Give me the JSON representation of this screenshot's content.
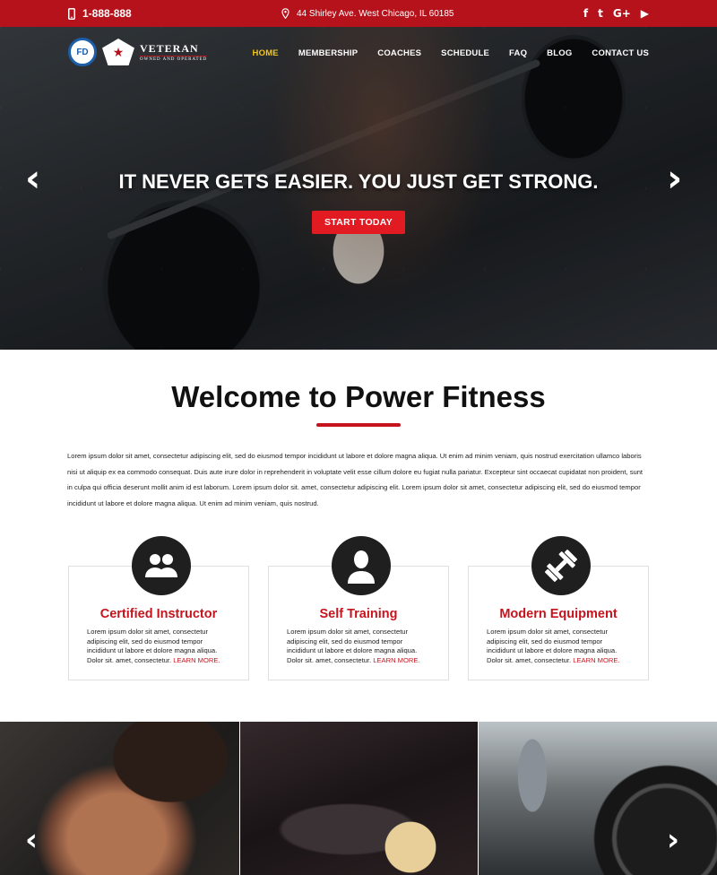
{
  "topbar": {
    "phone": "1-888-888",
    "address": "44 Shirley Ave. West Chicago, IL 60185",
    "social": [
      {
        "name": "facebook-icon",
        "glyph": "f"
      },
      {
        "name": "twitter-icon",
        "glyph": "t"
      },
      {
        "name": "google-plus-icon",
        "glyph": "G+"
      },
      {
        "name": "youtube-icon",
        "glyph": "▶"
      }
    ]
  },
  "logo": {
    "badge": "FD",
    "veteran": "VETERAN",
    "veteran_sub": "OWNED AND OPERATED"
  },
  "nav": {
    "items": [
      "HOME",
      "MEMBERSHIP",
      "COACHES",
      "SCHEDULE",
      "FAQ",
      "BLOG",
      "CONTACT US"
    ],
    "active": "HOME"
  },
  "hero": {
    "headline": "IT NEVER GETS EASIER. YOU JUST GET STRONG.",
    "cta": "START TODAY"
  },
  "welcome": {
    "title": "Welcome to Power Fitness",
    "paragraph": "Lorem ipsum dolor sit amet, consectetur adipiscing elit, sed do eiusmod tempor incididunt ut labore et dolore magna aliqua. Ut enim ad minim veniam, quis nostrud exercitation ullamco laboris nisi ut aliquip ex ea commodo consequat. Duis aute irure dolor in reprehenderit in voluptate velit esse cillum dolore eu fugiat nulla pariatur. Excepteur sint occaecat cupidatat non proident, sunt in culpa qui officia deserunt mollit anim id est laborum. Lorem ipsum dolor sit. amet, consectetur adipiscing elit. Lorem ipsum dolor sit amet, consectetur adipiscing elit, sed do eiusmod tempor incididunt ut labore et dolore magna aliqua. Ut enim ad minim veniam, quis nostrud."
  },
  "features": [
    {
      "title": "Certified Instructor",
      "icon": "group-icon",
      "text": "Lorem ipsum dolor sit amet, consectetur adipiscing elit, sed do eiusmod tempor incididunt ut labore et dolore magna aliqua. Dolor sit. amet, consectetur. ",
      "link": "LEARN MORE."
    },
    {
      "title": "Self Training",
      "icon": "person-icon",
      "text": "Lorem ipsum dolor sit amet, consectetur adipiscing elit, sed do eiusmod tempor incididunt ut labore et dolore magna aliqua. Dolor sit. amet, consectetur. ",
      "link": "LEARN MORE."
    },
    {
      "title": "Modern Equipment",
      "icon": "dumbbell-icon",
      "text": "Lorem ipsum dolor sit amet, consectetur adipiscing elit, sed do eiusmod tempor incididunt ut labore et dolore magna aliqua. Dolor sit. amet, consectetur. ",
      "link": "LEARN MORE."
    }
  ],
  "arrows": {
    "prev": "‹",
    "next": "›"
  },
  "colors": {
    "brand_red": "#b5121b",
    "accent_red": "#e21b23",
    "nav_active": "#f5c518"
  }
}
